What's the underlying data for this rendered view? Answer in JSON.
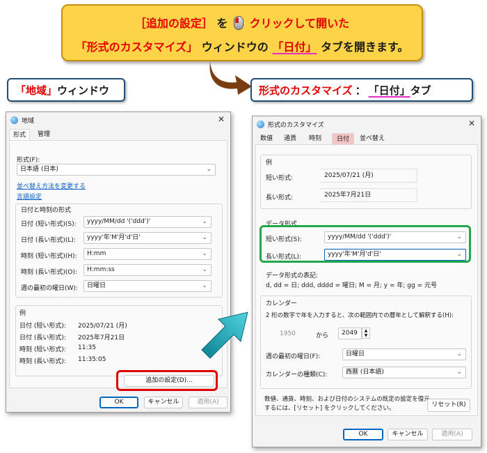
{
  "callout": {
    "line1": {
      "seg1": "［追加の設定］",
      "seg2": "を",
      "seg3": "クリックして開いた"
    },
    "line2": {
      "seg1": "「形式のカスタマイズ」",
      "seg2": "ウィンドウの",
      "seg3": "「日付」",
      "seg4": "タブを開きます。"
    }
  },
  "label_left": {
    "seg1": "「地域」",
    "seg2": "ウィンドウ"
  },
  "label_right": {
    "seg1": "形式のカスタマイズ",
    "seg2": "：",
    "seg3": "「日付」",
    "seg4": "タブ"
  },
  "region_window": {
    "title": "地域",
    "close": "✕",
    "tabs": [
      "形式",
      "管理"
    ],
    "format_label": "形式(F):",
    "format_value": "日本語 (日本)",
    "link_sort": "並べ替え方法を変更する",
    "link_language": "言語設定",
    "datetime_group": "日付と時刻の形式",
    "rows": [
      {
        "label": "日付 (短い形式)(S):",
        "value": "yyyy/MM/dd '('ddd')'"
      },
      {
        "label": "日付 (長い形式)(L):",
        "value": "yyyy'年'M'月'd'日'"
      },
      {
        "label": "時刻 (短い形式)(H):",
        "value": "H:mm"
      },
      {
        "label": "時刻 (長い形式)(O):",
        "value": "H:mm:ss"
      },
      {
        "label": "週の最初の曜日(W):",
        "value": "日曜日"
      }
    ],
    "example_label": "例",
    "examples": [
      {
        "label": "日付 (短い形式):",
        "value": "2025/07/21 (月)"
      },
      {
        "label": "日付 (長い形式):",
        "value": "2025年7月21日"
      },
      {
        "label": "時刻 (短い形式):",
        "value": "11:35"
      },
      {
        "label": "時刻 (長い形式):",
        "value": "11:35:05"
      }
    ],
    "additional_button": "追加の設定(D)...",
    "ok": "OK",
    "cancel": "キャンセル",
    "apply": "適用(A)"
  },
  "custom_window": {
    "title": "形式のカスタマイズ",
    "close": "✕",
    "tabs": [
      "数値",
      "通貨",
      "時刻",
      "日付",
      "並べ替え"
    ],
    "example_label": "例",
    "ex_short_label": "短い形式:",
    "ex_short_value": "2025/07/21 (月)",
    "ex_long_label": "長い形式:",
    "ex_long_value": "2025年7月21日",
    "dataformat_group": "データ形式",
    "df_short_label": "短い形式(S):",
    "df_short_value": "yyyy/MM/dd '('ddd')'",
    "df_long_label": "長い形式(L):",
    "df_long_value": "yyyy'年'M'月'd'日'",
    "notation_title": "データ形式の表記:",
    "notation_text": "d, dd = 日;  ddd, dddd = 曜日; M = 月; y = 年; gg = 元号",
    "calendar_group": "カレンダー",
    "calendar_desc": "2 桁の数字で年を入力すると、次の範囲内での暦年として解釈する(H):",
    "year_from": "1950",
    "year_sep": "から",
    "year_to": "2049",
    "first_day_label": "週の最初の曜日(F):",
    "first_day_value": "日曜日",
    "calendar_type_label": "カレンダーの種類(C):",
    "calendar_type_value": "西暦 (日本語)",
    "reset_text_1": "数値、通貨、時刻、および日付のシステムの既定の設定を復元",
    "reset_text_2": "するには、[リセット] をクリックしてください。",
    "reset": "リセット(R)",
    "ok": "OK",
    "cancel": "キャンセル",
    "apply": "適用(A)"
  }
}
